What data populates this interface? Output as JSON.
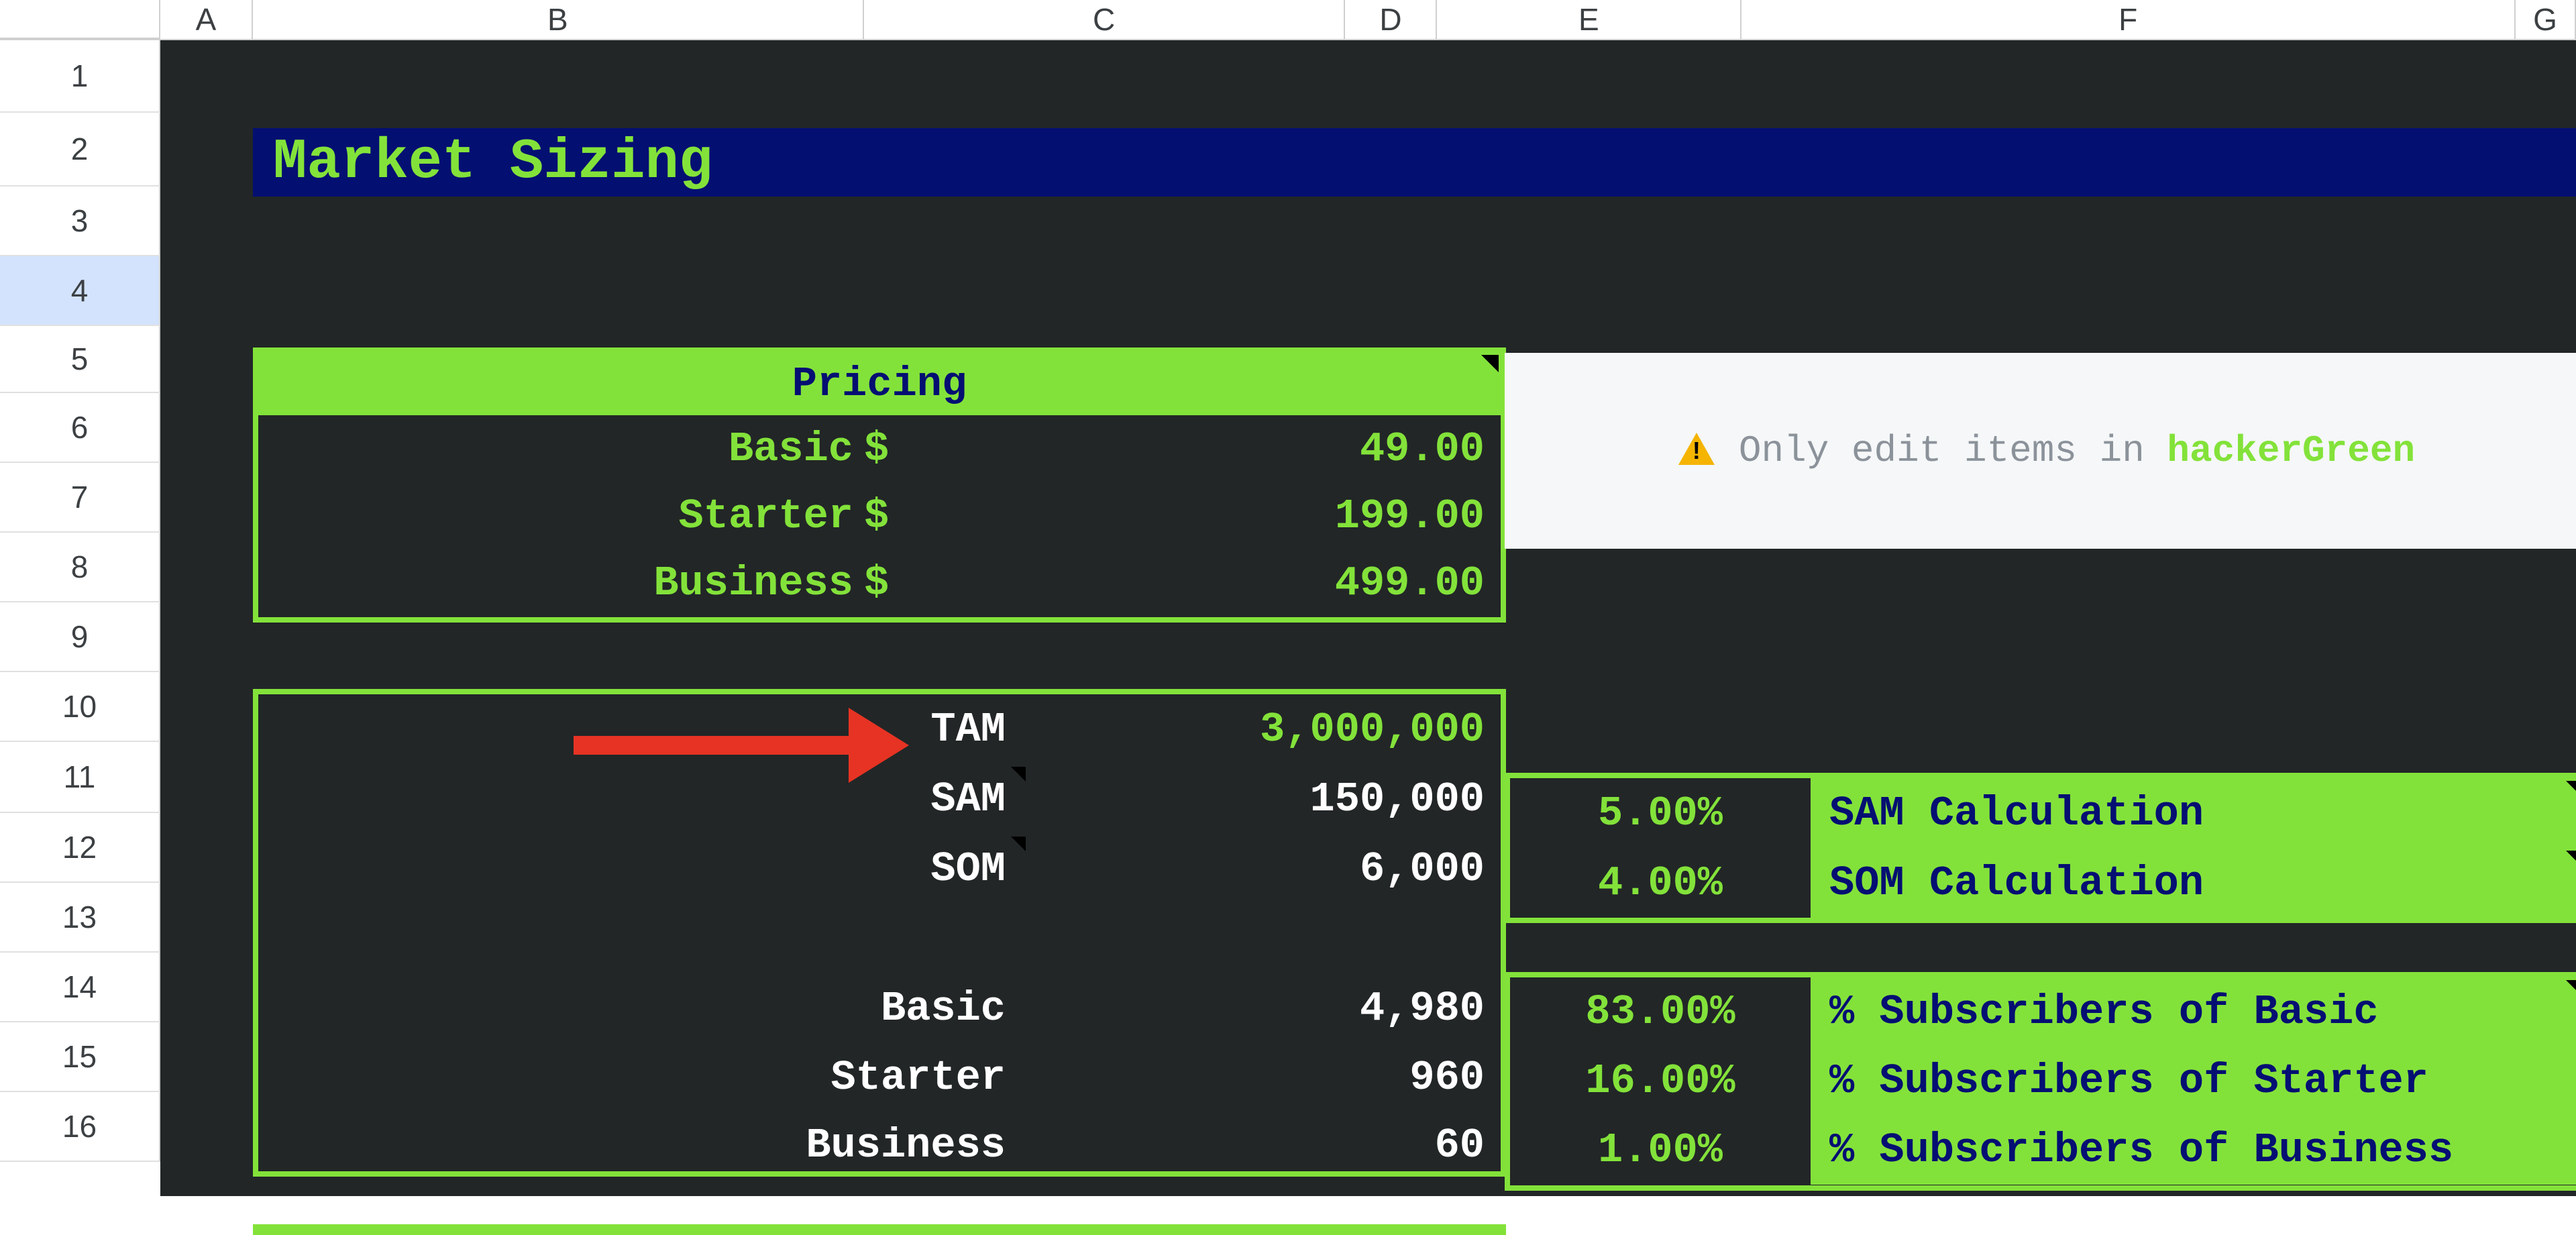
{
  "columns": {
    "A": "A",
    "B": "B",
    "C": "C",
    "D": "D",
    "E": "E",
    "F": "F",
    "G": "G"
  },
  "rows": [
    "1",
    "2",
    "3",
    "4",
    "5",
    "6",
    "7",
    "8",
    "9",
    "10",
    "11",
    "12",
    "13",
    "14",
    "15",
    "16"
  ],
  "title": "Market Sizing",
  "pricing": {
    "header": "Pricing",
    "currency": "$",
    "basic_label": "Basic",
    "starter_label": "Starter",
    "business_label": "Business",
    "basic_value": "49.00",
    "starter_value": "199.00",
    "business_value": "499.00"
  },
  "callout": {
    "text_prefix": "Only edit items in ",
    "highlight": "hackerGreen"
  },
  "market": {
    "tam_label": "TAM",
    "sam_label": "SAM",
    "som_label": "SOM",
    "tam_value": "3,000,000",
    "sam_value": "150,000",
    "som_value": "6,000",
    "basic_label": "Basic",
    "starter_label": "Starter",
    "business_label": "Business",
    "basic_value": "4,980",
    "starter_value": "960",
    "business_value": "60"
  },
  "calc": {
    "sam_pct": "5.00%",
    "som_pct": "4.00%",
    "sam_text": "SAM Calculation",
    "som_text": "SOM Calculation"
  },
  "subs": {
    "basic_pct": "83.00%",
    "starter_pct": "16.00%",
    "business_pct": "1.00%",
    "basic_text": "% Subscribers of Basic",
    "starter_text": "% Subscribers of Starter",
    "business_text": "% Subscribers of Business"
  },
  "selected_row": "4"
}
